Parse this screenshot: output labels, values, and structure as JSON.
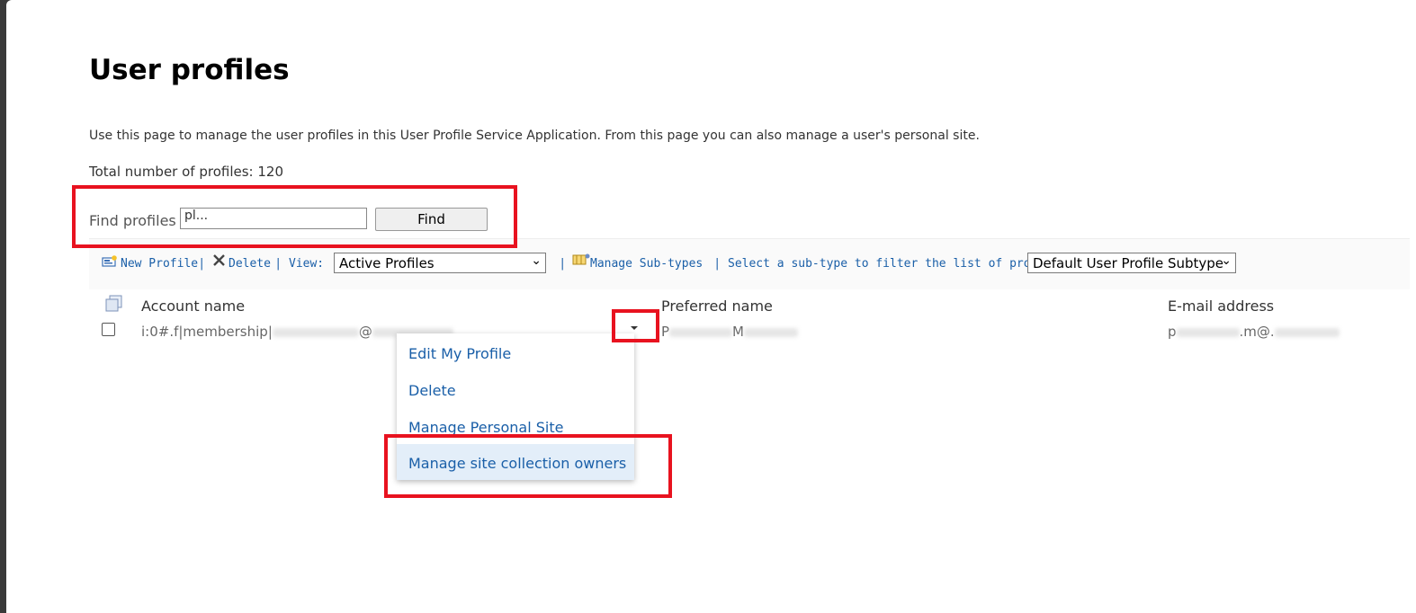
{
  "page": {
    "title": "User profiles",
    "description": "Use this page to manage the user profiles in this User Profile Service Application. From this page you can also manage a user's personal site.",
    "total_profiles": "Total number of profiles: 120"
  },
  "find": {
    "label": "Find profiles",
    "input_value": "pl...",
    "button_label": "Find"
  },
  "toolbar": {
    "new_profile": "New Profile",
    "delete": "Delete",
    "view_label": "View:",
    "view_selected": "Active Profiles",
    "manage_subtypes": "Manage Sub-types",
    "subtype_filter_label": "Select a sub-type to filter the list of profiles:",
    "subtype_selected": "Default User Profile Subtype",
    "separator": "|"
  },
  "table": {
    "headers": [
      "Account name",
      "Preferred name",
      "E-mail address"
    ],
    "rows": [
      {
        "account_prefix": "i:0#.f|membership|",
        "account_at": "@",
        "preferred_prefix": "P",
        "preferred_mid": "M",
        "email_prefix": "p",
        "email_mid": ".m@."
      }
    ]
  },
  "context_menu": {
    "items": [
      "Edit My Profile",
      "Delete",
      "Manage Personal Site",
      "Manage site collection owners"
    ],
    "highlighted_index": 3
  },
  "colors": {
    "link": "#1a5fa8",
    "annotation_box": "#e8121f",
    "highlight": "#e3eef9"
  }
}
